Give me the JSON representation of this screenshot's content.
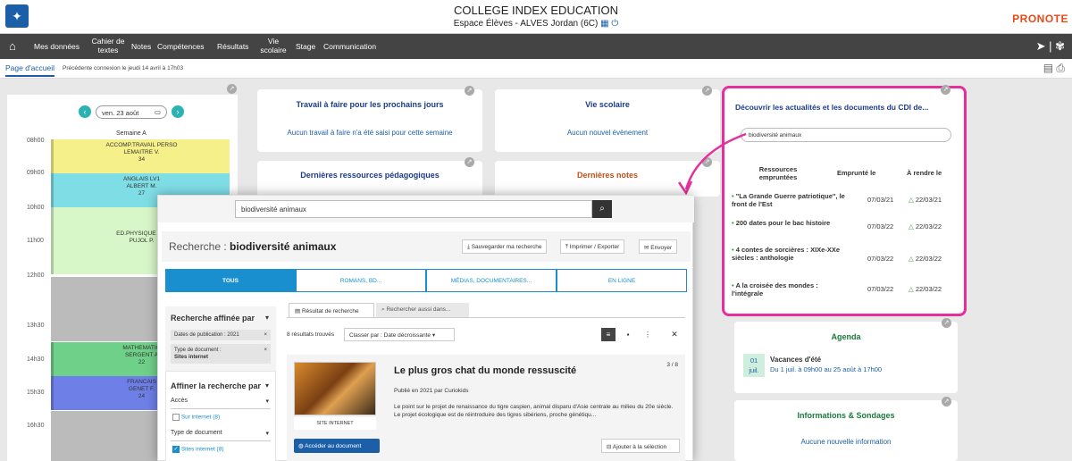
{
  "header": {
    "school": "COLLEGE INDEX EDUCATION",
    "space": "Espace Élèves - ALVES Jordan (6C)",
    "brand": "PRONOTE"
  },
  "nav": {
    "items": [
      "Mes données",
      "Cahier de textes",
      "Notes",
      "Compétences",
      "Résultats",
      "Vie scolaire",
      "Stage",
      "Communication"
    ]
  },
  "crumbs": {
    "tab": "Page d'accueil",
    "last_connection": "Précédente connexion le jeudi 14 avril à 17h03"
  },
  "schedule": {
    "date": "ven. 23 août",
    "week": "Semaine A",
    "hours": [
      "08h00",
      "09h00",
      "10h00",
      "11h00",
      "12h00",
      "13h30",
      "14h30",
      "15h30",
      "16h30"
    ],
    "courses": [
      {
        "line1": "ACCOMP.TRAVAIL PERSO",
        "line2": "LEMAITRE V.",
        "line3": "34",
        "color": "#f5f08a"
      },
      {
        "line1": "ANGLAIS LV1",
        "line2": "ALBERT M.",
        "line3": "27",
        "color": "#7fdde6"
      },
      {
        "line1": "ED.PHYSIQUE & S",
        "line2": "PUJOL P.",
        "line3": "",
        "color": "#d8f7c8"
      },
      {
        "line1": "MATHEMATIQ",
        "line2": "SERGENT A",
        "line3": "22",
        "color": "#6fd08a"
      },
      {
        "line1": "FRANCAIS",
        "line2": "GENET F.",
        "line3": "24",
        "color": "#6e7fe8"
      }
    ]
  },
  "panels": {
    "travail_title": "Travail à faire pour les prochains jours",
    "travail_note": "Aucun travail à faire n'a été saisi pour cette semaine",
    "vie_title": "Vie scolaire",
    "vie_note": "Aucun nouvel évènement",
    "ressources_title": "Dernières ressources pédagogiques",
    "notes_title": "Dernières notes"
  },
  "cdi": {
    "title": "Découvrir les actualités et les documents du CDI de...",
    "search": "biodiversité animaux",
    "col1": "Ressources empruntées",
    "col2": "Emprunté le",
    "col3": "À rendre le",
    "rows": [
      {
        "title": "\"La Grande Guerre patriotique\", le front de l'Est",
        "borrowed": "07/03/21",
        "due": "22/03/21"
      },
      {
        "title": "200 dates pour le bac histoire",
        "borrowed": "07/03/22",
        "due": "22/03/22"
      },
      {
        "title": "4 contes de sorcières : XIXe-XXe siècles : anthologie",
        "borrowed": "07/03/22",
        "due": "22/03/22"
      },
      {
        "title": "A la croisée des mondes : l'intégrale",
        "borrowed": "07/03/22",
        "due": "22/03/22"
      }
    ]
  },
  "agenda": {
    "title": "Agenda",
    "day": "01",
    "month": "juil.",
    "event": "Vacances d'été",
    "detail": "Du 1 juil. à 09h00 au 25 août à 17h00"
  },
  "info": {
    "title": "Informations & Sondages",
    "note": "Aucune nouvelle information"
  },
  "modal": {
    "search": "biodiversité animaux",
    "heading_prefix": "Recherche : ",
    "heading_query": "biodiversité animaux",
    "save": "Sauvegarder ma recherche",
    "print": "Imprimer / Exporter",
    "send": "Envoyer",
    "tabs": [
      "TOUS",
      "ROMANS, BD...",
      "MÉDIAS, DOCUMENTAIRES...",
      "EN LIGNE"
    ],
    "refine_title": "Recherche affinée par",
    "filter1": "Dates de publication : 2021",
    "filter2_a": "Type de document :",
    "filter2_b": "Sites internet",
    "refine2_title": "Affiner la recherche par",
    "acces": "Accès",
    "sur_internet": "Sur internet (8)",
    "type_doc": "Type de document",
    "sites_internet": "Sites internet (8)",
    "result_tab": "Résultat de recherche",
    "other_tab": "Rechercher aussi dans...",
    "results_count": "8 résultats trouvés",
    "sort": "Classer par : Date décroissante",
    "card_title": "Le plus gros chat du monde ressuscité",
    "card_pages": "3 / 8",
    "card_pub": "Publié en 2021 par Curiokids",
    "card_desc": "Le point sur le projet de renaissance du tigre caspien, animal disparu d'Asie centrale au milieu du 20e siècle. Le projet écologique est de réintroduire des tigres sibériens, proche génétiqu...",
    "card_label": "SITE INTERNET",
    "access_btn": "Accéder au document",
    "add_btn": "Ajouter à la sélection"
  }
}
